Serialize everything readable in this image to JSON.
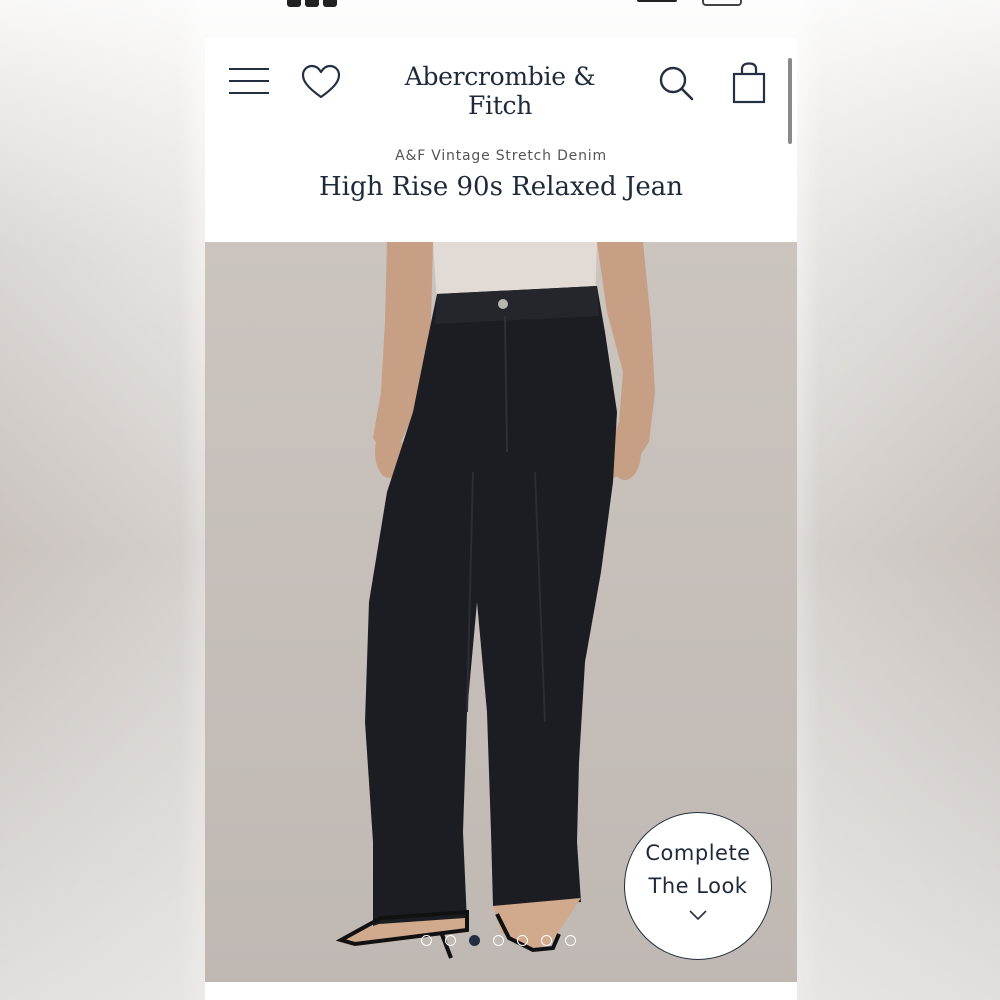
{
  "header": {
    "brand": "Abercrombie & Fitch",
    "icons": [
      "menu-icon",
      "heart-icon",
      "search-icon",
      "shopping-bag-icon"
    ]
  },
  "product": {
    "collection": "A&F Vintage Stretch Denim",
    "name": "High Rise 90s Relaxed Jean"
  },
  "gallery": {
    "complete_look_line1": "Complete",
    "complete_look_line2": "The Look",
    "dots_total": 7,
    "active_dot_index": 2
  },
  "colors": {
    "brand_navy": "#1e2a3a",
    "photo_background": "#c9c2bd",
    "jeans": "#1c1d22"
  }
}
